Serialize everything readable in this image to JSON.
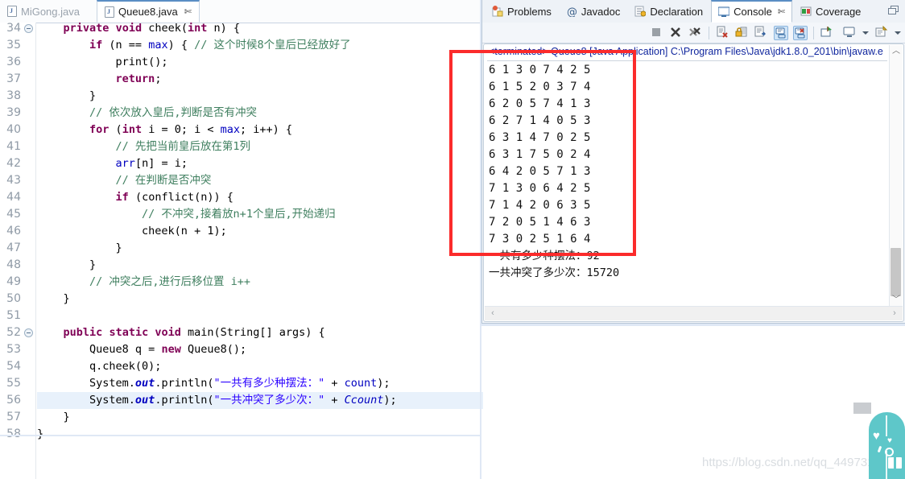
{
  "editor": {
    "tabs": [
      {
        "label": "MiGong.java",
        "icon": "java-file-icon",
        "active": false,
        "closable": false
      },
      {
        "label": "Queue8.java",
        "icon": "java-file-icon",
        "active": true,
        "closable": true
      }
    ],
    "close_glyph": "✄",
    "first_line_number": 34,
    "lines": [
      {
        "n": 34,
        "fold": true,
        "highlight": false,
        "changed": false
      },
      {
        "n": 35,
        "fold": false,
        "highlight": false,
        "changed": false
      },
      {
        "n": 36,
        "fold": false,
        "highlight": false,
        "changed": false
      },
      {
        "n": 37,
        "fold": false,
        "highlight": false,
        "changed": false
      },
      {
        "n": 38,
        "fold": false,
        "highlight": false,
        "changed": false
      },
      {
        "n": 39,
        "fold": false,
        "highlight": false,
        "changed": false
      },
      {
        "n": 40,
        "fold": false,
        "highlight": false,
        "changed": false
      },
      {
        "n": 41,
        "fold": false,
        "highlight": false,
        "changed": false
      },
      {
        "n": 42,
        "fold": false,
        "highlight": false,
        "changed": false
      },
      {
        "n": 43,
        "fold": false,
        "highlight": false,
        "changed": false
      },
      {
        "n": 44,
        "fold": false,
        "highlight": false,
        "changed": false
      },
      {
        "n": 45,
        "fold": false,
        "highlight": false,
        "changed": false
      },
      {
        "n": 46,
        "fold": false,
        "highlight": false,
        "changed": false
      },
      {
        "n": 47,
        "fold": false,
        "highlight": false,
        "changed": false
      },
      {
        "n": 48,
        "fold": false,
        "highlight": false,
        "changed": false
      },
      {
        "n": 49,
        "fold": false,
        "highlight": false,
        "changed": false
      },
      {
        "n": 50,
        "fold": false,
        "highlight": false,
        "changed": false
      },
      {
        "n": 51,
        "fold": false,
        "highlight": false,
        "changed": false
      },
      {
        "n": 52,
        "fold": true,
        "highlight": false,
        "changed": true
      },
      {
        "n": 53,
        "fold": false,
        "highlight": false,
        "changed": true
      },
      {
        "n": 54,
        "fold": false,
        "highlight": false,
        "changed": true
      },
      {
        "n": 55,
        "fold": false,
        "highlight": false,
        "changed": true
      },
      {
        "n": 56,
        "fold": false,
        "highlight": true,
        "changed": true
      },
      {
        "n": 57,
        "fold": false,
        "highlight": false,
        "changed": true
      },
      {
        "n": 58,
        "fold": false,
        "highlight": false,
        "changed": false
      }
    ],
    "code_text": [
      "    private void cheek(int n) {",
      "        if (n == max) { // 这个时候8个皇后已经放好了",
      "            print();",
      "            return;",
      "        }",
      "        // 依次放入皇后,判断是否有冲突",
      "        for (int i = 0; i < max; i++) {",
      "            // 先把当前皇后放在第1列",
      "            arr[n] = i;",
      "            // 在判断是否冲突",
      "            if (conflict(n)) {",
      "                // 不冲突,接着放n+1个皇后,开始递归",
      "                cheek(n + 1);",
      "            }",
      "        }",
      "        // 冲突之后,进行后移位置 i++",
      "    }",
      "",
      "    public static void main(String[] args) {",
      "        Queue8 q = new Queue8();",
      "        q.cheek(0);",
      "        System.out.println(\"一共有多少种摆法：\" + count);",
      "        System.out.println(\"一共冲突了多少次：\" + Ccount);",
      "    }",
      "}"
    ]
  },
  "console_panel": {
    "tabs": [
      {
        "label": "Problems",
        "icon": "problems-icon",
        "active": false,
        "closable": false
      },
      {
        "label": "Javadoc",
        "icon": "javadoc-at-icon",
        "active": false,
        "closable": false
      },
      {
        "label": "Declaration",
        "icon": "declaration-icon",
        "active": false,
        "closable": false
      },
      {
        "label": "Console",
        "icon": "console-icon",
        "active": true,
        "closable": true
      },
      {
        "label": "Coverage",
        "icon": "coverage-icon",
        "active": false,
        "closable": false
      }
    ],
    "close_glyph": "✄",
    "maximize_name": "restore-panel-icon",
    "toolbar_buttons": [
      {
        "name": "terminate-button",
        "glyph": "■",
        "selected": false
      },
      {
        "name": "remove-launch-button",
        "glyph": "✖",
        "selected": false
      },
      {
        "name": "remove-all-launches-button",
        "glyph": "✖",
        "selected": false
      },
      {
        "name": "clear-console-button",
        "glyph": "",
        "selected": false
      },
      {
        "name": "scroll-lock-button",
        "glyph": "",
        "selected": false
      },
      {
        "name": "word-wrap-button",
        "glyph": "",
        "selected": false
      },
      {
        "name": "show-console-on-output-button",
        "glyph": "",
        "selected": true
      },
      {
        "name": "show-console-on-error-button",
        "glyph": "",
        "selected": true
      },
      {
        "name": "pin-console-button",
        "glyph": "",
        "selected": false
      },
      {
        "name": "display-selected-console-button",
        "glyph": "",
        "selected": false
      },
      {
        "name": "open-console-button",
        "glyph": "",
        "selected": false
      }
    ],
    "terminated_line": "<terminated> Queue8 [Java Application] C:\\Program Files\\Java\\jdk1.8.0_201\\bin\\javaw.e",
    "output_rows": [
      "6 1 3 0 7 4 2 5",
      "6 1 5 2 0 3 7 4",
      "6 2 0 5 7 4 1 3",
      "6 2 7 1 4 0 5 3",
      "6 3 1 4 7 0 2 5",
      "6 3 1 7 5 0 2 4",
      "6 4 2 0 5 7 1 3",
      "7 1 3 0 6 4 2 5",
      "7 1 4 2 0 6 3 5",
      "7 2 0 5 1 4 6 3",
      "7 3 0 2 5 1 6 4"
    ],
    "summary_lines": [
      {
        "label": "一共有多少种摆法：",
        "value": "92"
      },
      {
        "label": "一共冲突了多少次：",
        "value": "15720"
      }
    ],
    "scroll_up_glyph": "︿",
    "scroll_down_glyph": "﹀",
    "scroll_left_glyph": "‹",
    "scroll_right_glyph": "›"
  },
  "annotation": {
    "name": "red-highlight-box",
    "color": "#fb2b2b"
  },
  "watermark": {
    "text": "https://blog.csdn.net/qq_44973159"
  },
  "corner_widget": {
    "name": "teal-gift-widget",
    "color": "#5ec7c9"
  }
}
